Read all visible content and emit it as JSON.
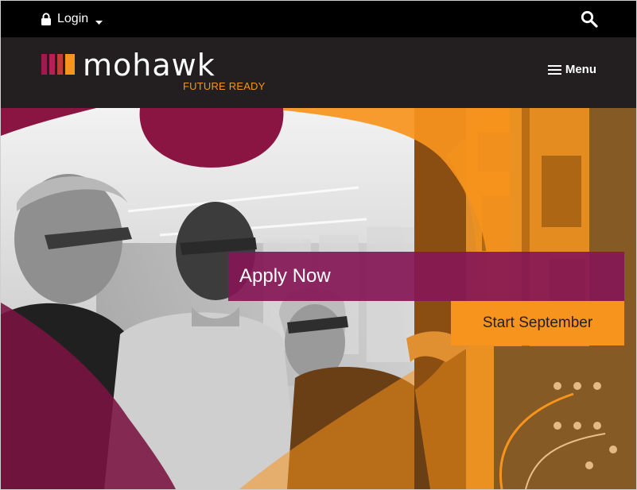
{
  "topbar": {
    "login_label": "Login",
    "icons": {
      "lock": "lock-icon",
      "caret": "caret-down-icon",
      "search": "search-icon"
    }
  },
  "header": {
    "brand": "mohawk",
    "tagline": "FUTURE READY",
    "menu_label": "Menu",
    "icons": {
      "menu": "hamburger-icon",
      "logo_mark": "mohawk-bars-logo"
    }
  },
  "hero": {
    "apply_label": "Apply Now",
    "start_label": "Start September"
  },
  "colors": {
    "topbar_bg": "#000000",
    "header_bg": "#231f20",
    "brand_orange": "#f7941d",
    "brand_maroon": "#851756"
  }
}
